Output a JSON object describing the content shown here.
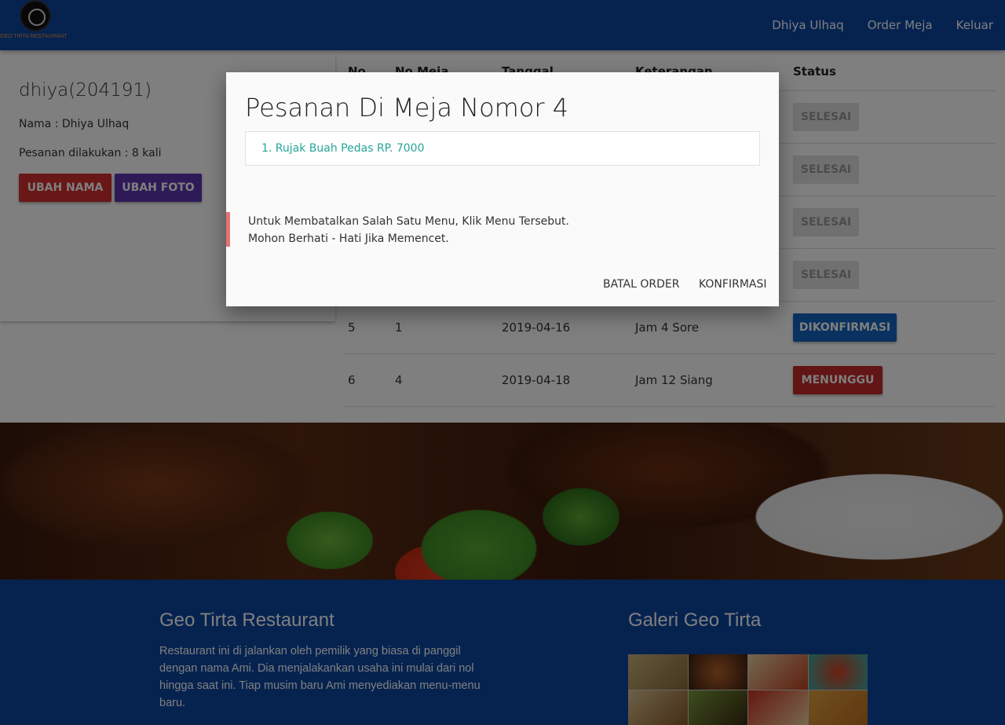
{
  "navbar": {
    "logo_text": "GEO TIRTA RESTAURANT",
    "links": [
      "Dhiya Ulhaq",
      "Order Meja",
      "Keluar"
    ]
  },
  "profile": {
    "username": "dhiya(204191)",
    "name": "Nama : Dhiya Ulhaq",
    "orders": "Pesanan dilakukan : 8 kali",
    "rename_button": "UBAH NAMA",
    "photo_button": "UBAH FOTO"
  },
  "table": {
    "headers": [
      "No",
      "No Meja",
      "Tanggal",
      "Keterangan",
      "Status"
    ],
    "status_done_label": "SELESAI",
    "rows": [
      {
        "no": "5",
        "meja": "1",
        "tanggal": "2019-04-16",
        "keterangan": "Jam 4 Sore",
        "status": "DIKONFIRMASI"
      },
      {
        "no": "6",
        "meja": "4",
        "tanggal": "2019-04-18",
        "keterangan": "Jam 12 Siang",
        "status": "MENUNGGU"
      }
    ]
  },
  "footer": {
    "title": "Geo Tirta Restaurant",
    "description": "Restaurant ini di jalankan oleh pemilik yang biasa di panggil dengan nama Ami. Dia menjalakankan usaha ini mulai dari nol hingga saat ini. Tiap musim baru Ami menyediakan menu-menu baru.",
    "gallery_title": "Galeri Geo Tirta"
  },
  "modal": {
    "title": "Pesanan Di Meja Nomor 4",
    "items": [
      "1. Rujak Buah Pedas RP. 7000"
    ],
    "notice_line1": "Untuk Membatalkan Salah Satu Menu, Klik Menu Tersebut.",
    "notice_line2": "Mohon Berhati - Hati Jika Memencet.",
    "cancel_button": "BATAL ORDER",
    "confirm_button": "KONFIRMASI"
  },
  "colors": {
    "primary": "#0d47a1",
    "danger": "#d32f2f",
    "purple": "#5e35b1",
    "teal_link": "#26a69a",
    "notice_border": "#e57373"
  }
}
